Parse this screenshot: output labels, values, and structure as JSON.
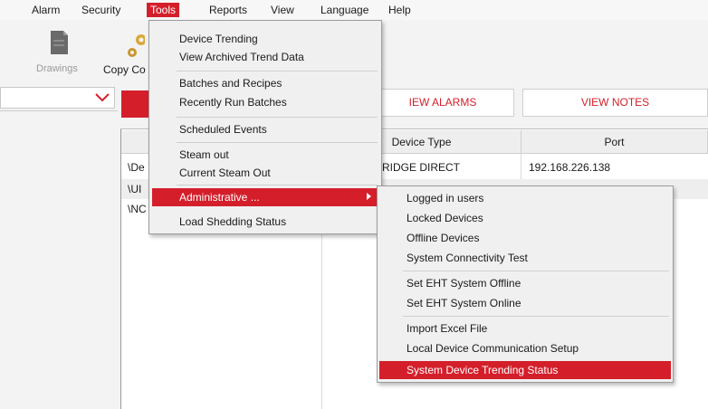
{
  "menubar": {
    "items": [
      {
        "label": "Alarm"
      },
      {
        "label": "Security"
      },
      {
        "label": "Tools"
      },
      {
        "label": "Reports"
      },
      {
        "label": "View"
      },
      {
        "label": "Language"
      },
      {
        "label": "Help"
      }
    ]
  },
  "toolbar": {
    "drawings_label": "Drawings",
    "copy_label": "Copy Co"
  },
  "main": {
    "view_alarms_label": "IEW ALARMS",
    "view_notes_label": "VIEW NOTES",
    "columns": [
      "Device Type",
      "Port"
    ],
    "rows": [
      {
        "name": "\\De",
        "device_type": "RIDGE DIRECT",
        "port": "192.168.226.138"
      },
      {
        "name": "\\UI",
        "device_type": "",
        "port": ""
      },
      {
        "name": "\\NC",
        "device_type": "",
        "port": ""
      }
    ]
  },
  "tools_menu": {
    "items": [
      {
        "label": "Device Trending"
      },
      {
        "label": "View Archived Trend Data"
      },
      {
        "label": "Batches and Recipes"
      },
      {
        "label": "Recently Run Batches"
      },
      {
        "label": "Scheduled Events"
      },
      {
        "label": "Steam out"
      },
      {
        "label": "Current Steam Out"
      },
      {
        "label": "Administrative ..."
      },
      {
        "label": "Load Shedding Status"
      }
    ]
  },
  "admin_menu": {
    "items": [
      {
        "label": "Logged in users"
      },
      {
        "label": "Locked Devices"
      },
      {
        "label": "Offline Devices"
      },
      {
        "label": "System Connectivity Test"
      },
      {
        "label": "Set EHT System Offline"
      },
      {
        "label": "Set EHT System Online"
      },
      {
        "label": "Import Excel File"
      },
      {
        "label": "Local Device Communication Setup"
      },
      {
        "label": "System Device Trending Status"
      }
    ]
  },
  "colors": {
    "accent": "#d41f2b",
    "menu_bg": "#f0f0f0"
  },
  "icons": [
    "drawings-icon",
    "copy-icon",
    "chevron-down-icon",
    "submenu-arrow-icon"
  ]
}
